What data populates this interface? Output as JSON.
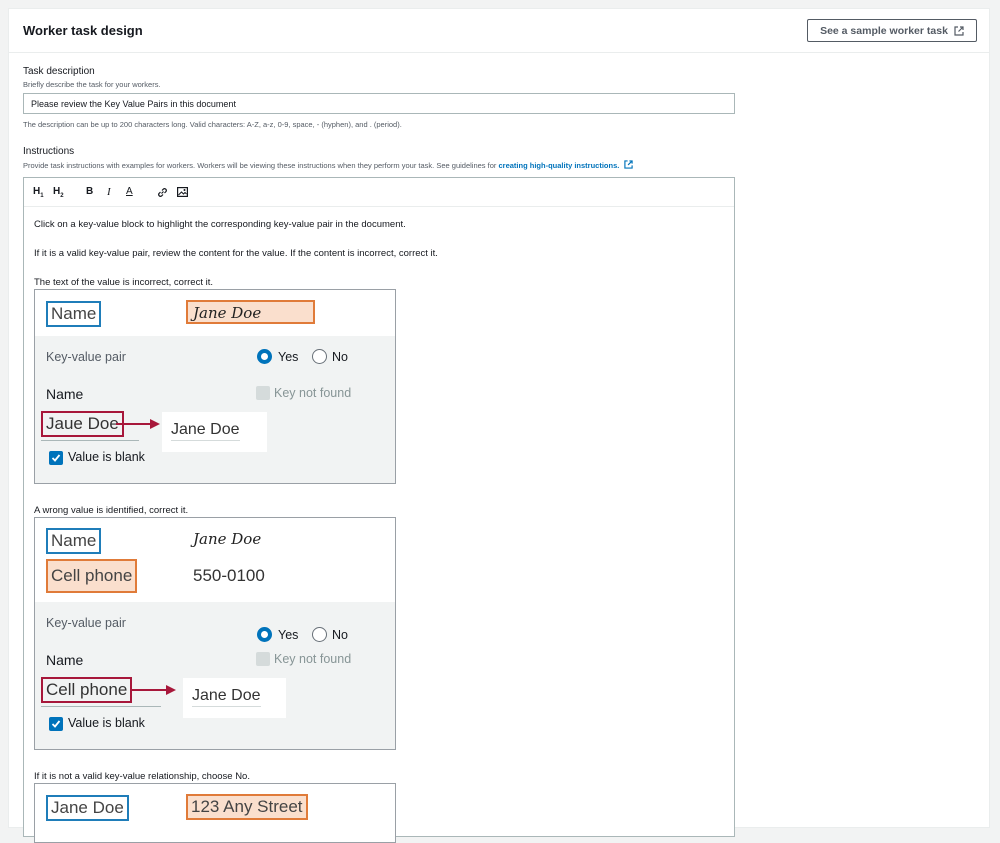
{
  "panel": {
    "title": "Worker task design",
    "sample_button": "See a sample worker task",
    "sample_icon": "external-link-icon"
  },
  "task_description": {
    "label": "Task description",
    "hint": "Briefly describe the task for your workers.",
    "value": "Please review the Key Value Pairs in this document",
    "constraint": "The description can be up to 200 characters long. Valid characters: A-Z, a-z, 0-9, space, - (hyphen), and . (period)."
  },
  "instructions": {
    "label": "Instructions",
    "hint": "Provide task instructions with examples for workers. Workers will be viewing these instructions when they perform your task. See guidelines for ",
    "link": "creating high-quality instructions.",
    "toolbar": [
      "H1",
      "H2",
      "B",
      "I",
      "A",
      "link-icon",
      "image-icon"
    ],
    "paragraphs": [
      "Click on a key-value block to highlight the corresponding key-value pair in the document.",
      "If it is a valid key-value pair, review the content for the value. If the content is incorrect, correct it.",
      "The text of the value is incorrect, correct it.",
      "A wrong value is identified, correct it.",
      "If it is not a valid key-value relationship, choose No."
    ]
  },
  "example1": {
    "doc_key": "Name",
    "doc_value": "Jane Doe",
    "kv_label": "Key-value pair",
    "yes": "Yes",
    "no": "No",
    "key": "Name",
    "key_not_found": "Key not found",
    "old_value": "Jaue Doe",
    "new_value": "Jane Doe",
    "value_blank": "Value is blank"
  },
  "example2": {
    "doc_key1": "Name",
    "doc_value1": "Jane Doe",
    "doc_key2": "Cell phone",
    "doc_value2": "550-0100",
    "kv_label": "Key-value pair",
    "yes": "Yes",
    "no": "No",
    "key": "Name",
    "key_not_found": "Key not found",
    "old_value": "Cell phone",
    "new_value": "Jane Doe",
    "value_blank": "Value is blank"
  },
  "example3": {
    "doc_key": "Jane Doe",
    "doc_value": "123 Any Street"
  },
  "colors": {
    "accent": "#0073bb",
    "key_box": "#1f7db9",
    "value_box": "#e07b39",
    "error_box": "#a7173a"
  }
}
